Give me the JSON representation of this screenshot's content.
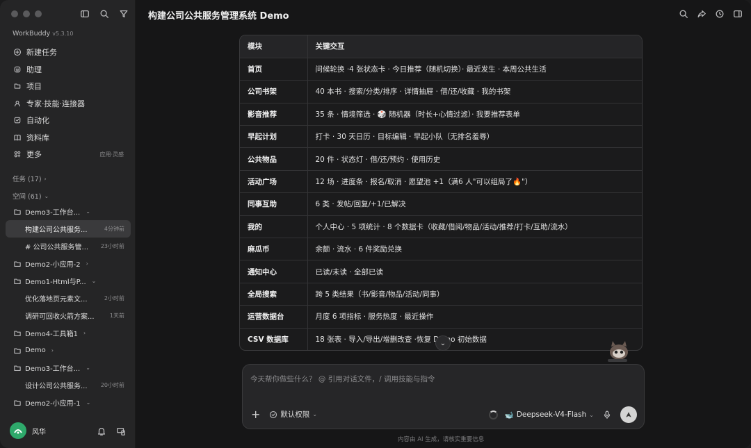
{
  "app": {
    "name": "WorkBuddy",
    "version": "v5.3.10"
  },
  "nav": [
    {
      "label": "新建任务",
      "icon": "plus-circle-icon"
    },
    {
      "label": "助理",
      "icon": "assistant-icon"
    },
    {
      "label": "项目",
      "icon": "project-icon"
    },
    {
      "label": "专家·技能·连接器",
      "icon": "expert-icon"
    },
    {
      "label": "自动化",
      "icon": "automation-icon"
    },
    {
      "label": "资料库",
      "icon": "library-icon"
    },
    {
      "label": "更多",
      "icon": "more-icon",
      "extra": "应用·灵感"
    }
  ],
  "sections": {
    "tasks": "任务 (17)",
    "spaces": "空间 (61)"
  },
  "tree": [
    {
      "label": "Demo3-工作台...",
      "type": "folder",
      "chev": "v"
    },
    {
      "label": "构建公司公共服务...",
      "type": "child",
      "time": "4分钟前",
      "active": true
    },
    {
      "label": "# 公司公共服务管...",
      "type": "child",
      "time": "23小时前"
    },
    {
      "label": "Demo2-小应用-2",
      "type": "folder",
      "chev": ">"
    },
    {
      "label": "Demo1-Html与P...",
      "type": "folder",
      "chev": "v"
    },
    {
      "label": "优化落地页元素文...",
      "type": "child",
      "time": "2小时前"
    },
    {
      "label": "调研可回收火箭方案...",
      "type": "child",
      "time": "1天前"
    },
    {
      "label": "Demo4-工具箱1",
      "type": "folder",
      "chev": ">"
    },
    {
      "label": "Demo",
      "type": "folder",
      "chev": ">"
    },
    {
      "label": "Demo3-工作台...",
      "type": "folder",
      "chev": "v"
    },
    {
      "label": "设计公司公共服务...",
      "type": "child",
      "time": "20小时前"
    },
    {
      "label": "Demo2-小应用-1",
      "type": "folder",
      "chev": "v"
    }
  ],
  "user": {
    "name": "风华"
  },
  "main": {
    "title": "构建公司公共服务管理系统 Demo"
  },
  "table": {
    "headers": [
      "模块",
      "关键交互"
    ],
    "rows": [
      [
        "首页",
        "问候轮换 ·4 张状态卡 · 今日推荐（随机切换）· 最近发生 · 本周公共生活"
      ],
      [
        "公司书架",
        "40 本书 · 搜索/分类/排序 · 详情抽屉 · 借/还/收藏 · 我的书架"
      ],
      [
        "影音推荐",
        "35 条 · 情境筛选 · 🎲 随机器（时长+心情过滤）· 我要推荐表单"
      ],
      [
        "早起计划",
        "打卡 · 30 天日历 · 目标编辑 · 早起小队（无排名羞辱）"
      ],
      [
        "公共物品",
        "20 件 · 状态灯 · 借/还/预约 · 使用历史"
      ],
      [
        "活动广场",
        "12 场 · 进度条 · 报名/取消 · 愿望池 +1（满6 人\"可以组局了🔥\"）"
      ],
      [
        "同事互助",
        "6 类 · 发帖/回复/+1/已解决"
      ],
      [
        "我的",
        "个人中心 · 5 项统计 · 8 个数据卡（收藏/借阅/物品/活动/推荐/打卡/互助/流水）"
      ],
      [
        "麻瓜币",
        "余额 · 流水 · 6 件奖励兑换"
      ],
      [
        "通知中心",
        "已读/未读 · 全部已读"
      ],
      [
        "全局搜索",
        "跨 5 类结果（书/影音/物品/活动/同事）"
      ],
      [
        "运营数据台",
        "月度 6 项指标 · 服务热度 · 最近操作"
      ],
      [
        "CSV 数据库",
        "18 张表 · 导入/导出/增删改查 ·恢复 Demo 初始数据"
      ]
    ]
  },
  "composer": {
    "placeholder": "今天帮你做些什么？ @ 引用对话文件，/ 调用技能与指令",
    "permission": "默认权限",
    "model": "Deepseek-V4-Flash"
  },
  "footer": "内容由 AI 生成，请核实重要信息"
}
